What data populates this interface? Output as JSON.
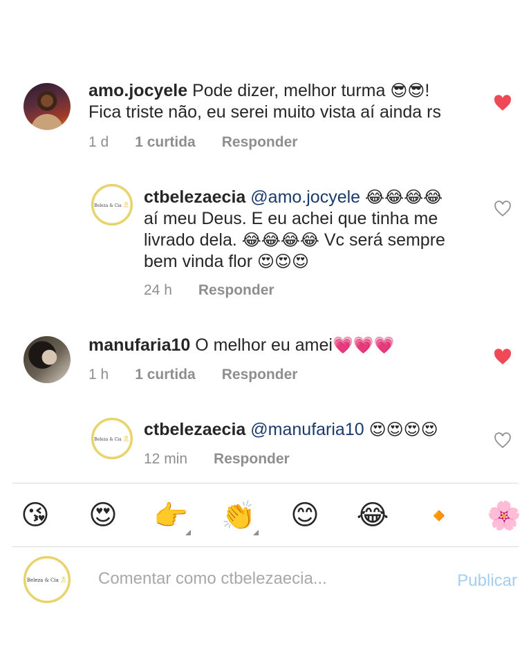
{
  "comments": [
    {
      "username": "amo.jocyele",
      "text1": "Pode dizer, melhor turma ",
      "text1_emoji": "😎😎",
      "text1_end": "!",
      "text2": "Fica triste não, eu serei muito vista aí ainda rs",
      "time": "1 d",
      "likes": "1 curtida",
      "reply": "Responder",
      "liked": true
    },
    {
      "username": "ctbelezaecia",
      "mention": "@amo.jocyele",
      "emoji_a": "😂😂😂😂",
      "line2": "aí meu Deus. E eu achei que tinha me",
      "line3": "livrado dela. ",
      "emoji_b": "😂😂😂😂",
      "line3_end": " Vc será sempre",
      "line4": "bem vinda flor ",
      "emoji_c": "😍😍😍",
      "time": "24 h",
      "reply": "Responder",
      "liked": false
    },
    {
      "username": "manufaria10",
      "text": "O melhor  eu amei",
      "emoji": "💗💗💗",
      "time": "1 h",
      "likes": "1 curtida",
      "reply": "Responder",
      "liked": true
    },
    {
      "username": "ctbelezaecia",
      "mention": "@manufaria10",
      "emoji": "😍😍😍😍",
      "time": "12 min",
      "reply": "Responder",
      "liked": false
    }
  ],
  "brand_logo": {
    "name": "Beleza & Cia",
    "ribbon": "🎗"
  },
  "emoji_bar": [
    {
      "name": "kissing-face-icon",
      "glyph": "😘"
    },
    {
      "name": "heart-eyes-icon",
      "glyph": "😍"
    },
    {
      "name": "pointing-hand-icon",
      "glyph": "👉"
    },
    {
      "name": "clapping-hands-icon",
      "glyph": "👏"
    },
    {
      "name": "smiling-face-icon",
      "glyph": "😊"
    },
    {
      "name": "tears-of-joy-icon",
      "glyph": "😂"
    },
    {
      "name": "orange-diamond-icon",
      "glyph": "🔸"
    },
    {
      "name": "cherry-blossom-icon",
      "glyph": "🌸"
    }
  ],
  "input": {
    "placeholder": "Comentar como ctbelezaecia...",
    "publish_label": "Publicar"
  },
  "colors": {
    "heart_liked": "#ed4956",
    "muted_text": "#8e8e8e",
    "publish": "#a5cdef",
    "mention": "#1a3a6b"
  }
}
